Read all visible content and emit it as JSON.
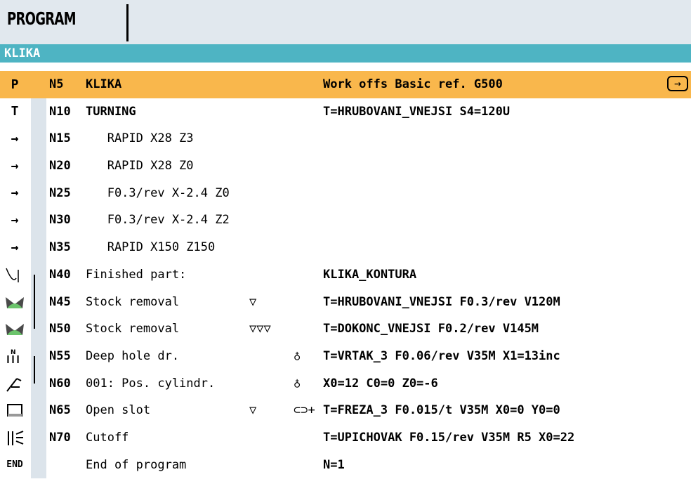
{
  "header": {
    "title": "PROGRAM"
  },
  "program_name": "KLIKA",
  "rows": [
    {
      "sym": "P",
      "nr": "N5",
      "desc": "KLIKA",
      "info": "Work offs Basic ref. G500",
      "selected": true
    },
    {
      "sym": "T",
      "nr": "N10",
      "desc": "TURNING",
      "info": "T=HRUBOVANI_VNEJSI S4=120U"
    },
    {
      "sym": "→",
      "nr": "N15",
      "desc": "   RAPID X28 Z3",
      "info": ""
    },
    {
      "sym": "→",
      "nr": "N20",
      "desc": "   RAPID X28 Z0",
      "info": ""
    },
    {
      "sym": "→",
      "nr": "N25",
      "desc": "   F0.3/rev X-2.4 Z0",
      "info": ""
    },
    {
      "sym": "→",
      "nr": "N30",
      "desc": "   F0.3/rev X-2.4 Z2",
      "info": ""
    },
    {
      "sym": "→",
      "nr": "N35",
      "desc": "   RAPID X150 Z150",
      "info": ""
    },
    {
      "sym": "contour",
      "nr": "N40",
      "desc": "Finished part:",
      "info": "KLIKA_KONTURA"
    },
    {
      "sym": "stock",
      "nr": "N45",
      "desc": "Stock removal",
      "mark": "▽",
      "info": "T=HRUBOVANI_VNEJSI F0.3/rev V120M"
    },
    {
      "sym": "stock",
      "nr": "N50",
      "desc": "Stock removal",
      "mark": "▽▽▽",
      "info": "T=DOKONC_VNEJSI F0.2/rev V145M"
    },
    {
      "sym": "deep",
      "nr": "N55",
      "desc": "Deep hole dr.",
      "mark": "♁",
      "info": "T=VRTAK_3 F0.06/rev V35M X1=13inc"
    },
    {
      "sym": "pos",
      "nr": "N60",
      "desc": "001: Pos. cylindr.",
      "mark": "♁",
      "info": "X0=12 C0=0 Z0=-6"
    },
    {
      "sym": "slot",
      "nr": "N65",
      "desc": "Open slot",
      "mark": "▽",
      "mark2": "⊂⊃+",
      "info": "T=FREZA_3 F0.015/t V35M X0=0 Y0=0"
    },
    {
      "sym": "cutoff",
      "nr": "N70",
      "desc": "Cutoff",
      "info": "T=UPICHOVAK F0.15/rev V35M R5 X0=22"
    },
    {
      "sym": "END",
      "nr": "",
      "desc": "End of program",
      "info": "N=1"
    }
  ]
}
